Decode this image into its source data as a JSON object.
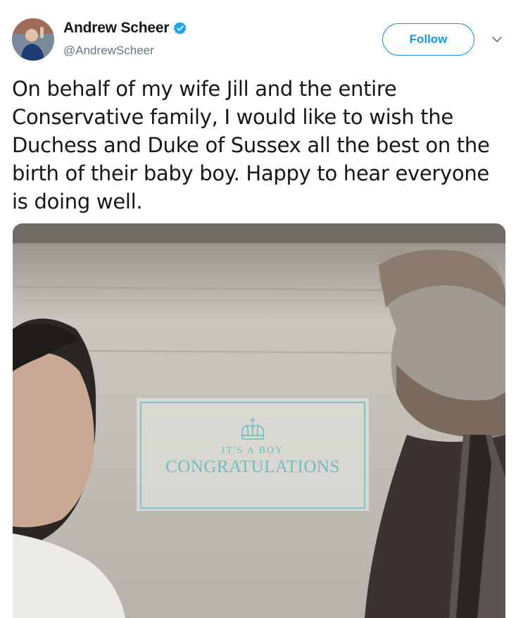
{
  "author": {
    "display_name": "Andrew Scheer",
    "handle": "@AndrewScheer",
    "verified": true,
    "avatar_icon": "profile-photo"
  },
  "follow_button": {
    "label": "Follow"
  },
  "menu": {
    "icon": "chevron-down-icon"
  },
  "tweet": {
    "text": "On behalf of my wife Jill and the entire Conservative family, I would like to wish the Duchess and Duke of Sussex all the best on the birth of their baby boy. Happy to hear everyone is doing well."
  },
  "media": {
    "overlay_subtitle": "IT'S A BOY",
    "overlay_title": "CONGRATULATIONS",
    "overlay_icon": "crown-icon"
  },
  "colors": {
    "accent": "#1b95e0",
    "overlay_teal": "#6fbdc4",
    "secondary_text": "#657786"
  }
}
